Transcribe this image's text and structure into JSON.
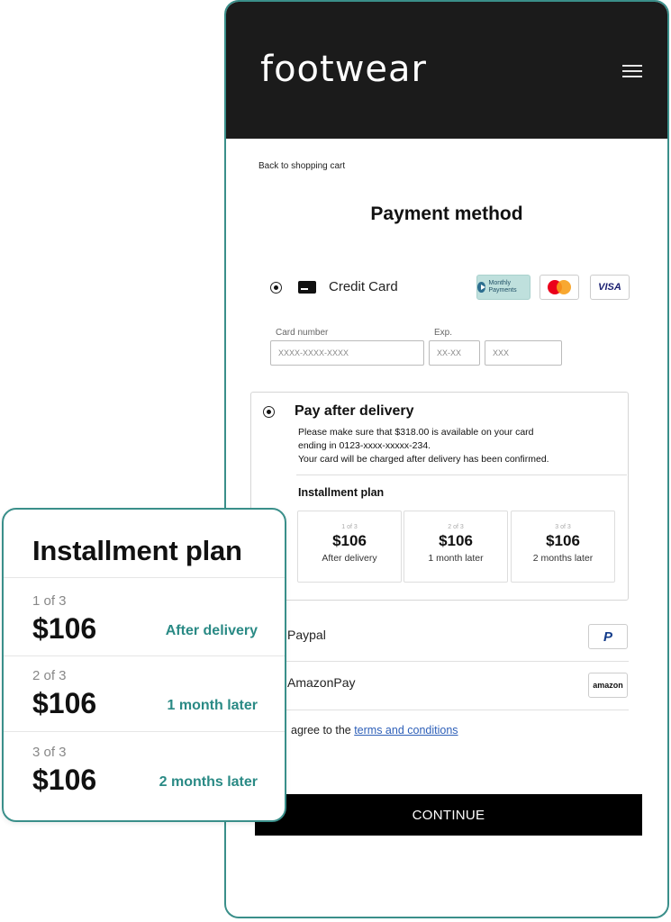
{
  "header": {
    "logo": "footwear"
  },
  "back_link": "Back to shopping cart",
  "page_title": "Payment method",
  "credit_card": {
    "label": "Credit Card",
    "badges": {
      "monthly": "Monthly Payments",
      "visa": "VISA"
    },
    "card_number_label": "Card number",
    "card_number_placeholder": "XXXX-XXXX-XXXX",
    "exp_label": "Exp.",
    "exp_placeholder": "XX-XX",
    "cvv_placeholder": "XXX"
  },
  "pay_after_delivery": {
    "title": "Pay after delivery",
    "desc_line1": "Please make sure that $318.00 is available on your card",
    "desc_line2": "ending in 0123-xxxx-xxxxx-234.",
    "desc_line3": "Your card will be charged after delivery has been confirmed.",
    "installment_label": "Installment plan",
    "installments": [
      {
        "of": "1 of 3",
        "amount": "$106",
        "when": "After delivery"
      },
      {
        "of": "2 of 3",
        "amount": "$106",
        "when": "1 month later"
      },
      {
        "of": "3 of 3",
        "amount": "$106",
        "when": "2 months later"
      }
    ]
  },
  "paypal": {
    "label": "Paypal",
    "icon_text": "P"
  },
  "amazonpay": {
    "label": "AmazonPay",
    "icon_text": "amazon"
  },
  "agree": {
    "text": "agree to the ",
    "link": "terms and conditions"
  },
  "continue_label": "CONTINUE",
  "overlay": {
    "title": "Installment plan",
    "rows": [
      {
        "of": "1 of 3",
        "amount": "$106",
        "when": "After delivery"
      },
      {
        "of": "2 of 3",
        "amount": "$106",
        "when": "1 month later"
      },
      {
        "of": "3 of 3",
        "amount": "$106",
        "when": "2 months later"
      }
    ]
  },
  "colors": {
    "accent": "#3a8f8a",
    "teal_text": "#2a8a85",
    "header_bg": "#1b1b1b",
    "link": "#2d5fb8"
  }
}
